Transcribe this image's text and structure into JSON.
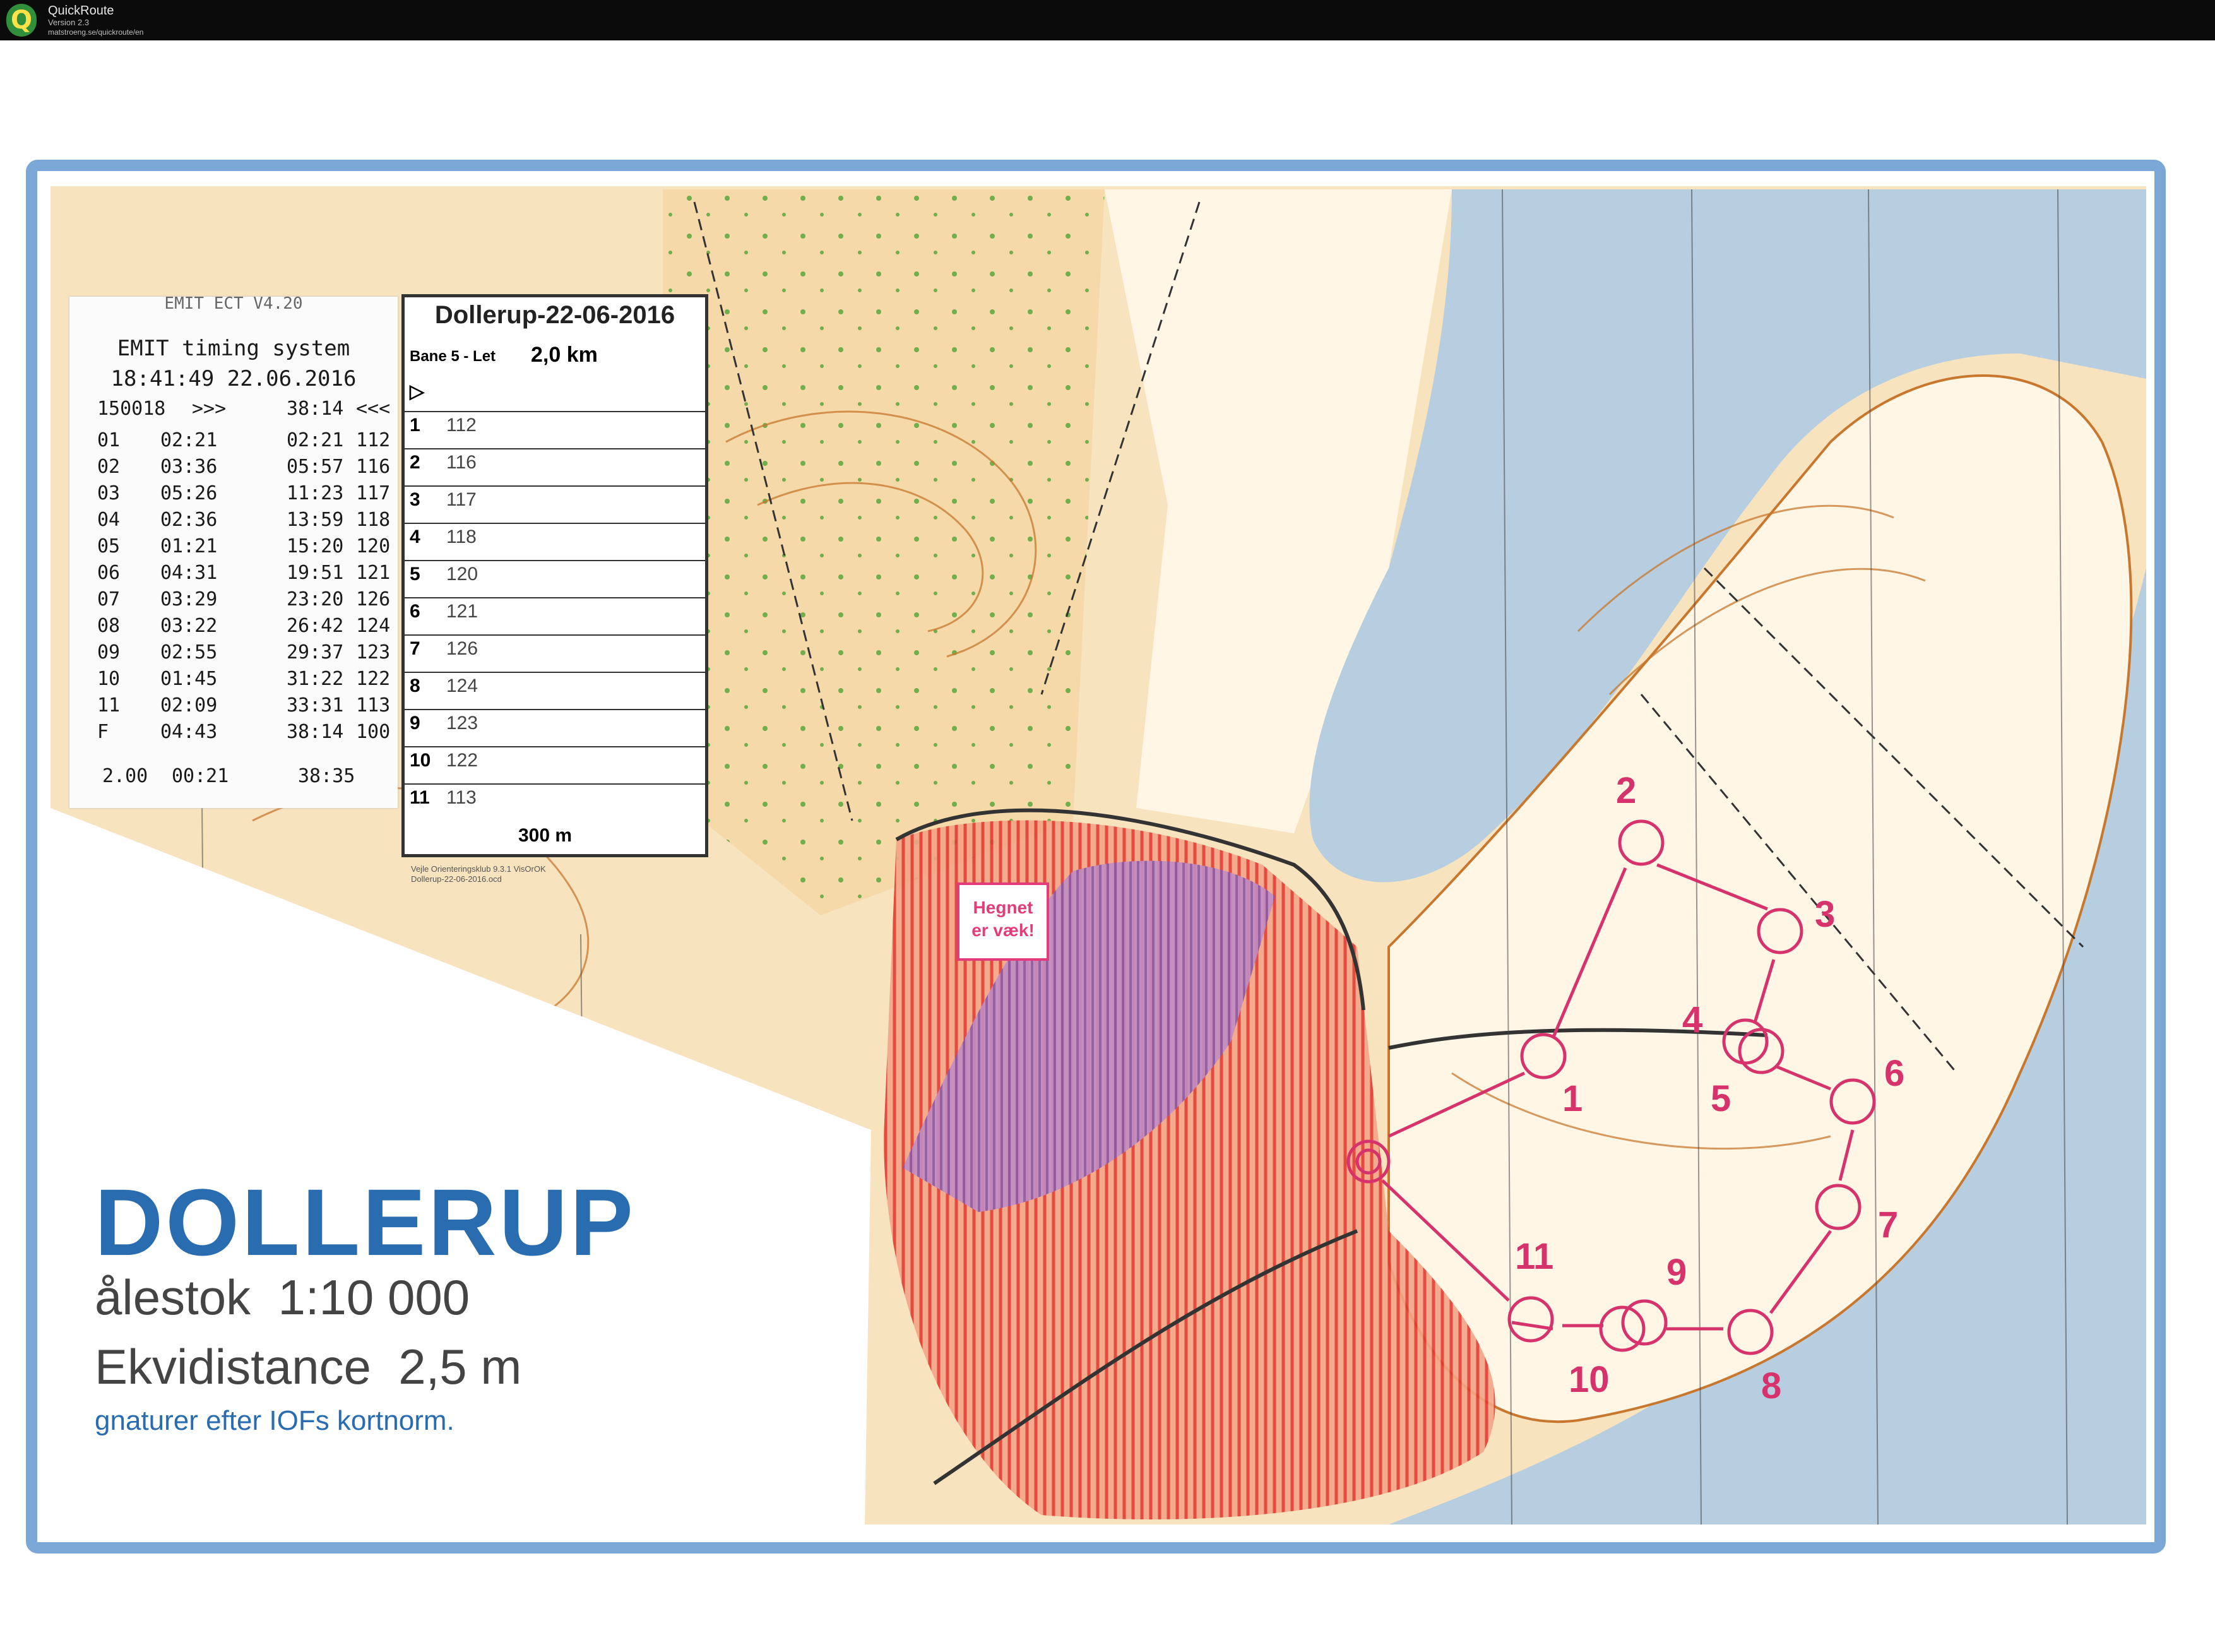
{
  "app": {
    "name": "QuickRoute",
    "version": "Version 2.3",
    "url": "matstroeng.se/quickroute/en"
  },
  "map": {
    "title": "DOLLERUP",
    "scale": "1:10 000",
    "scale_label": "ålestok",
    "contour_label": "Ekvidistance",
    "contour": "2,5 m",
    "symbols_note": "gnaturer efter IOFs kortnorm.",
    "fence_note_line1": "Hegnet",
    "fence_note_line2": "er væk!",
    "colors": {
      "course": "#d6336c",
      "water": "#b7cde0",
      "terrain": "#f5d9a8",
      "contour": "#c8782e",
      "frame": "#7aa7d6",
      "forbidden": "#e03a30"
    },
    "controls": [
      "1",
      "2",
      "3",
      "4",
      "5",
      "6",
      "7",
      "8",
      "9",
      "10",
      "11"
    ]
  },
  "receipt": {
    "header_partial": "EMIT ECT V4.20",
    "system": "EMIT timing system",
    "datetime": "18:41:49  22.06.2016",
    "card": "150018",
    "card_mark_left": ">>>",
    "total_top": "38:14",
    "total_mark_right": "<<<",
    "splits": [
      {
        "leg": "01",
        "split": "02:21",
        "cum": "02:21",
        "code": "112"
      },
      {
        "leg": "02",
        "split": "03:36",
        "cum": "05:57",
        "code": "116"
      },
      {
        "leg": "03",
        "split": "05:26",
        "cum": "11:23",
        "code": "117"
      },
      {
        "leg": "04",
        "split": "02:36",
        "cum": "13:59",
        "code": "118"
      },
      {
        "leg": "05",
        "split": "01:21",
        "cum": "15:20",
        "code": "120"
      },
      {
        "leg": "06",
        "split": "04:31",
        "cum": "19:51",
        "code": "121"
      },
      {
        "leg": "07",
        "split": "03:29",
        "cum": "23:20",
        "code": "126"
      },
      {
        "leg": "08",
        "split": "03:22",
        "cum": "26:42",
        "code": "124"
      },
      {
        "leg": "09",
        "split": "02:55",
        "cum": "29:37",
        "code": "123"
      },
      {
        "leg": "10",
        "split": "01:45",
        "cum": "31:22",
        "code": "122"
      },
      {
        "leg": "11",
        "split": "02:09",
        "cum": "33:31",
        "code": "113"
      },
      {
        "leg": "F",
        "split": "04:43",
        "cum": "38:14",
        "code": "100"
      }
    ],
    "footer_a": "2.00",
    "footer_b": "00:21",
    "footer_c": "38:35"
  },
  "description": {
    "title": "Dollerup-22-06-2016",
    "course": "Bane 5 - Let",
    "distance": "2,0 km",
    "rows": [
      {
        "n": "1",
        "code": "112"
      },
      {
        "n": "2",
        "code": "116"
      },
      {
        "n": "3",
        "code": "117"
      },
      {
        "n": "4",
        "code": "118"
      },
      {
        "n": "5",
        "code": "120"
      },
      {
        "n": "6",
        "code": "121"
      },
      {
        "n": "7",
        "code": "126"
      },
      {
        "n": "8",
        "code": "124"
      },
      {
        "n": "9",
        "code": "123"
      },
      {
        "n": "10",
        "code": "122"
      },
      {
        "n": "11",
        "code": "113"
      }
    ],
    "leg_to_finish": "300 m",
    "footnote1": "Vejle Orienteringsklub 9.3.1 VisOrOK",
    "footnote2": "Dollerup-22-06-2016.ocd"
  }
}
